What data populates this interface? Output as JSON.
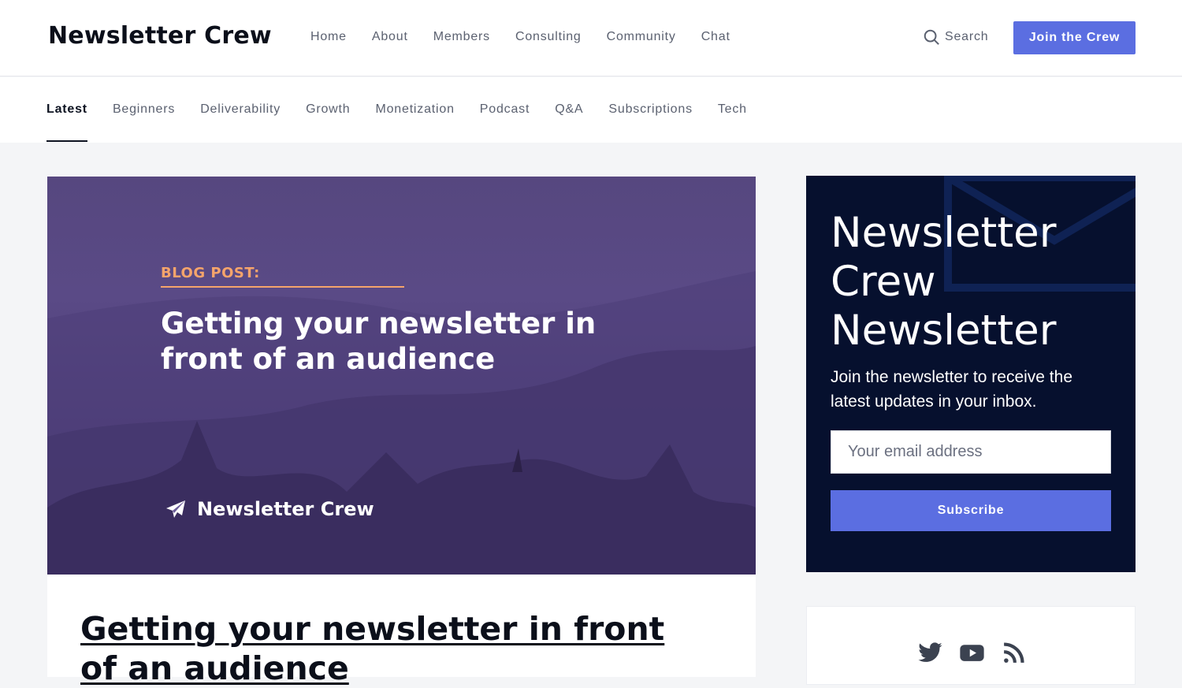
{
  "header": {
    "logo": "Newsletter Crew",
    "nav": [
      "Home",
      "About",
      "Members",
      "Consulting",
      "Community",
      "Chat"
    ],
    "search_label": "Search",
    "join_label": "Join the Crew"
  },
  "categories": {
    "items": [
      "Latest",
      "Beginners",
      "Deliverability",
      "Growth",
      "Monetization",
      "Podcast",
      "Q&A",
      "Subscriptions",
      "Tech"
    ],
    "active": "Latest"
  },
  "feature": {
    "label": "BLOG POST:",
    "title": "Getting your newsletter in front of an audience",
    "brand": "Newsletter Crew",
    "post_title": "Getting your newsletter in front of an audience"
  },
  "newsletter": {
    "title": "Newsletter Crew Newsletter",
    "description": "Join the newsletter to receive the latest updates in your inbox.",
    "email_placeholder": "Your email address",
    "subscribe_label": "Subscribe"
  },
  "social": {
    "icons": [
      "twitter-icon",
      "youtube-icon",
      "rss-icon"
    ]
  },
  "colors": {
    "accent": "#5b6ee1",
    "sidebar_bg": "#06102e",
    "label_orange": "#f5a46b"
  }
}
